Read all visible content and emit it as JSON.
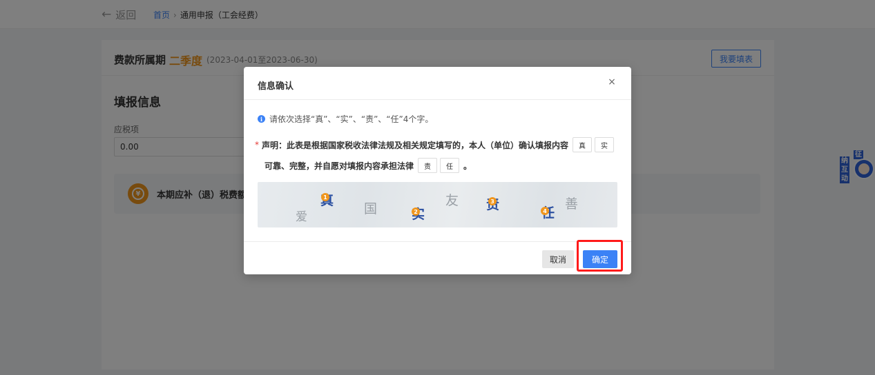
{
  "topbar": {
    "back_label": "返回",
    "breadcrumb": {
      "home": "首页",
      "separator": "›",
      "current": "通用申报（工会经费）"
    }
  },
  "period": {
    "label": "费款所属期",
    "value": "二季度",
    "range": "(2023-04-01至2023-06-30)",
    "fill_button": "我要填表"
  },
  "form": {
    "section_title": "填报信息",
    "field_label": "应税项",
    "field_value": "0.00",
    "summary_text": "本期应补（退）税费额"
  },
  "side_badge": {
    "chars": [
      "征",
      "纳",
      "互",
      "动"
    ]
  },
  "modal": {
    "title": "信息确认",
    "close_symbol": "×",
    "tip": "请依次选择“真”、“实”、“责”、“任”4个字。",
    "required_mark": "*",
    "declaration_part1": "声明：此表是根据国家税收法律法规及相关规定填写的，本人（单位）确认填报内容",
    "declaration_part2": "可靠、完整，并自愿对填报内容承担法律",
    "declaration_end": "。",
    "slots": [
      "真",
      "实",
      "责",
      "任"
    ],
    "captcha": {
      "chars": [
        "爱",
        "真",
        "国",
        "实",
        "友",
        "责",
        "任",
        "善"
      ],
      "marks": [
        "1",
        "2",
        "3",
        "4"
      ]
    },
    "cancel_label": "取消",
    "ok_label": "确定"
  },
  "colors": {
    "accent": "#3b82f6",
    "orange": "#f0961d",
    "highlight": "#ff1a1a"
  }
}
